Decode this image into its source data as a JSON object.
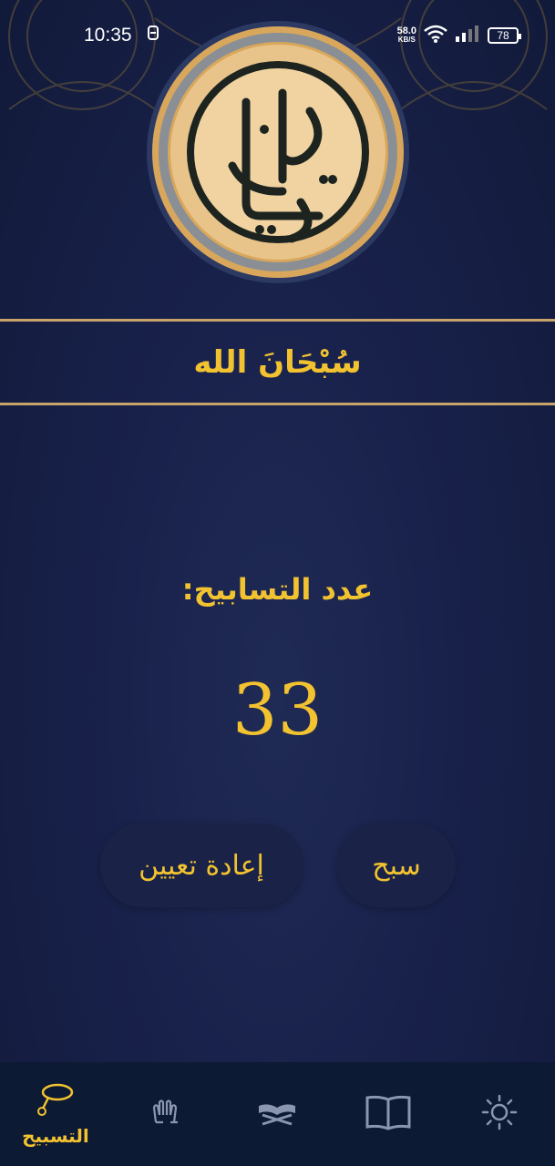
{
  "status_bar": {
    "time": "10:35",
    "net_speed_value": "58.0",
    "net_speed_unit": "KB/S",
    "battery": "78"
  },
  "dhikr": {
    "text": "سُبْحَانَ الله"
  },
  "counter": {
    "label": ":عدد التسابيح",
    "value": "33"
  },
  "buttons": {
    "reset_label": "إعادة تعيين",
    "count_label": "سبح"
  },
  "bottom_nav": {
    "items": [
      {
        "label": "التسبيح",
        "icon": "tasbih-beads-icon",
        "active": true
      },
      {
        "label": "",
        "icon": "praying-hands-icon",
        "active": false
      },
      {
        "label": "",
        "icon": "quran-stand-icon",
        "active": false
      },
      {
        "label": "",
        "icon": "open-book-icon",
        "active": false
      },
      {
        "label": "",
        "icon": "sun-icon",
        "active": false
      }
    ]
  },
  "colors": {
    "background": "#18214a",
    "accent_gold": "#f2c230",
    "divider": "#c9a46a",
    "nav_background": "#0d1a33",
    "button_background": "#1a2347"
  }
}
